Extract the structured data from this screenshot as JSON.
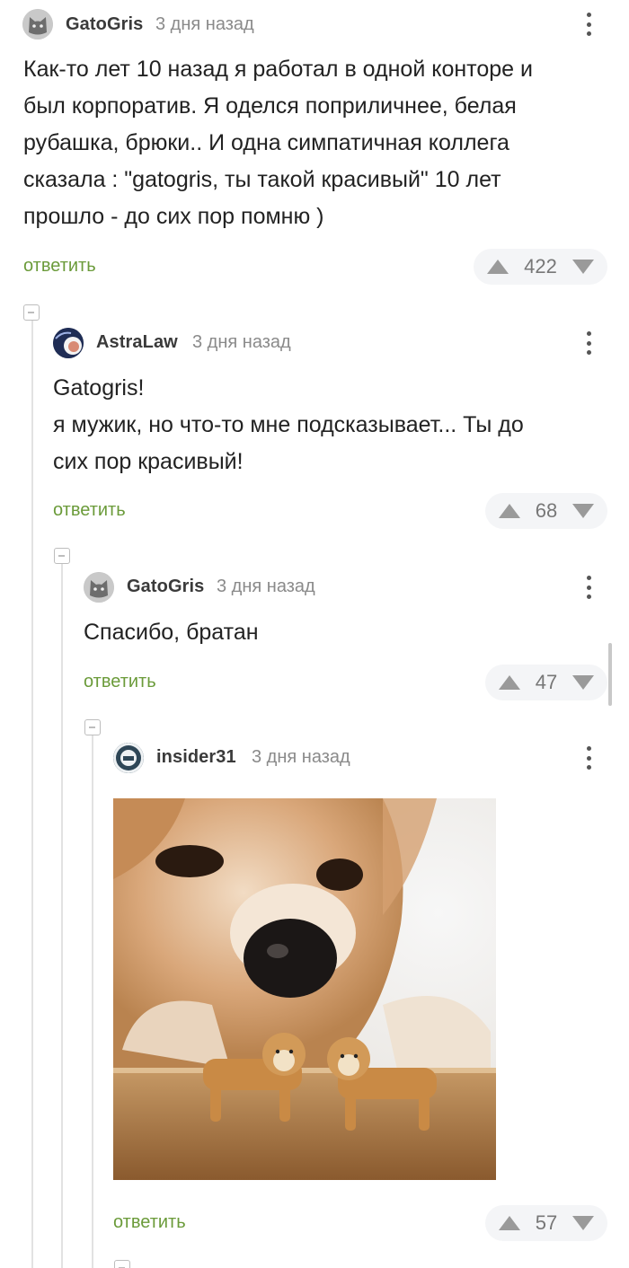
{
  "comments": [
    {
      "username": "GatoGris",
      "time": "3 дня назад",
      "lines": [
        "Как-то лет 10 назад я работал в одной конторе и",
        "был корпоратив. Я оделся поприличнее, белая",
        "рубашка, брюки.. И одна симпатичная коллега",
        "сказала : \"gatogris, ты такой красивый\" 10 лет",
        "прошло - до сих пор помню )"
      ],
      "reply_label": "ответить",
      "rating": "422"
    },
    {
      "username": "AstraLaw",
      "time": "3 дня назад",
      "lines": [
        "Gatogris!",
        "я мужик, но что-то мне подсказывает... Ты до",
        "сих пор красивый!"
      ],
      "reply_label": "ответить",
      "rating": "68"
    },
    {
      "username": "GatoGris",
      "time": "3 дня назад",
      "lines": [
        "Спасибо, братан"
      ],
      "reply_label": "ответить",
      "rating": "47"
    },
    {
      "username": "insider31",
      "time": "3 дня назад",
      "image_icon": "shiba-inu-photo",
      "reply_label": "ответить",
      "rating": "57"
    }
  ],
  "icons": {
    "upvote": "triangle-up-icon",
    "downvote": "triangle-down-icon",
    "more": "kebab-menu-icon",
    "collapse": "collapse-minus-icon"
  },
  "colors": {
    "reply_link": "#6b9b3a",
    "vote_bg": "#f4f5f7",
    "thread_line": "#e2e2e2"
  }
}
